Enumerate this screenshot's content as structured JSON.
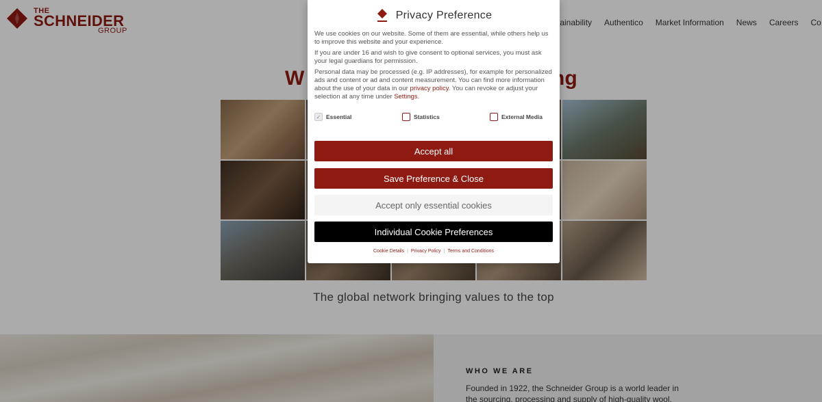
{
  "header": {
    "logo": {
      "line1": "THE",
      "line2": "SCHNEIDER",
      "line3": "GROUP"
    },
    "nav": [
      "stainability",
      "Authentico",
      "Market Information",
      "News",
      "Careers",
      "Co"
    ]
  },
  "hero": {
    "headline_left": "W",
    "headline_right": "ng",
    "tagline": "The global network bringing values to the top"
  },
  "who_we_are": {
    "title": "WHO WE ARE",
    "text": "Founded in 1922, the Schneider Group is a world leader in the sourcing, processing and supply of high-quality wool,"
  },
  "modal": {
    "title": "Privacy Preference",
    "paragraph1": "We use cookies on our website. Some of them are essential, while others help us to improve this website and your experience.",
    "paragraph2": "If you are under 16 and wish to give consent to optional services, you must ask your legal guardians for permission.",
    "paragraph3_a": "Personal data may be processed (e.g. IP addresses), for example for personalized ads and content or ad and content measurement. You can find more information about the use of your data in our ",
    "privacy_link": "privacy policy",
    "paragraph3_b": ". You can revoke or adjust your selection at any time under ",
    "settings_link": "Settings",
    "paragraph3_c": ".",
    "checkboxes": [
      {
        "label": "Essential",
        "checked": true,
        "disabled": true
      },
      {
        "label": "Statistics",
        "checked": false
      },
      {
        "label": "External Media",
        "checked": false
      }
    ],
    "buttons": {
      "accept_all": "Accept all",
      "save_close": "Save Preference & Close",
      "essential_only": "Accept only essential cookies",
      "individual": "Individual Cookie Preferences"
    },
    "footer_links": [
      "Cookie Details",
      "Privacy Policy",
      "Terms and Conditions"
    ]
  },
  "colors": {
    "brand": "#8f1a12",
    "dark_button": "#000000",
    "light_button": "#f4f4f4"
  }
}
